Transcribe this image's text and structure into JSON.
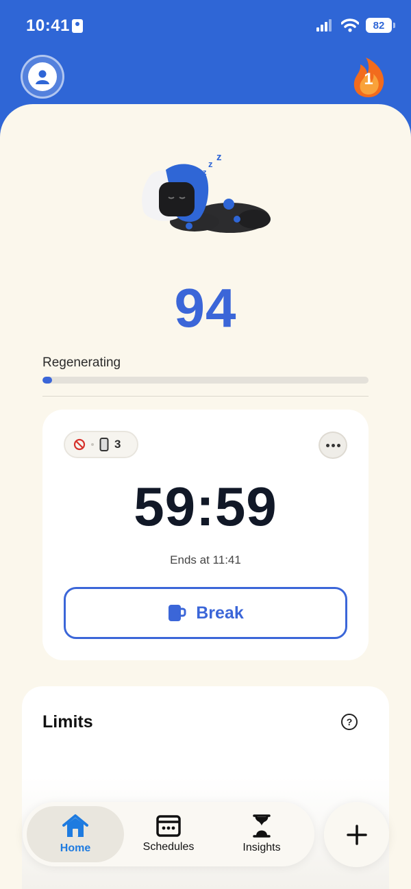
{
  "status_bar": {
    "time": "10:41",
    "battery": "82"
  },
  "header": {
    "streak_count": "1"
  },
  "focus": {
    "score": "94",
    "state_label": "Regenerating",
    "progress_fraction": 0.03
  },
  "session": {
    "blocked_count": "3",
    "timer": "59:59",
    "ends_at": "Ends at 11:41",
    "break_label": "Break"
  },
  "limits": {
    "title": "Limits"
  },
  "tabs": [
    {
      "label": "Home",
      "icon": "house-icon",
      "active": true
    },
    {
      "label": "Schedules",
      "icon": "calendar-icon",
      "active": false
    },
    {
      "label": "Insights",
      "icon": "hourglass-icon",
      "active": false
    }
  ],
  "colors": {
    "brand_blue": "#2f66d6",
    "accent_blue": "#3b66d8",
    "tab_active": "#1e7be0",
    "sheet_bg": "#fbf7ec",
    "streak_orange": "#f26b1d"
  }
}
